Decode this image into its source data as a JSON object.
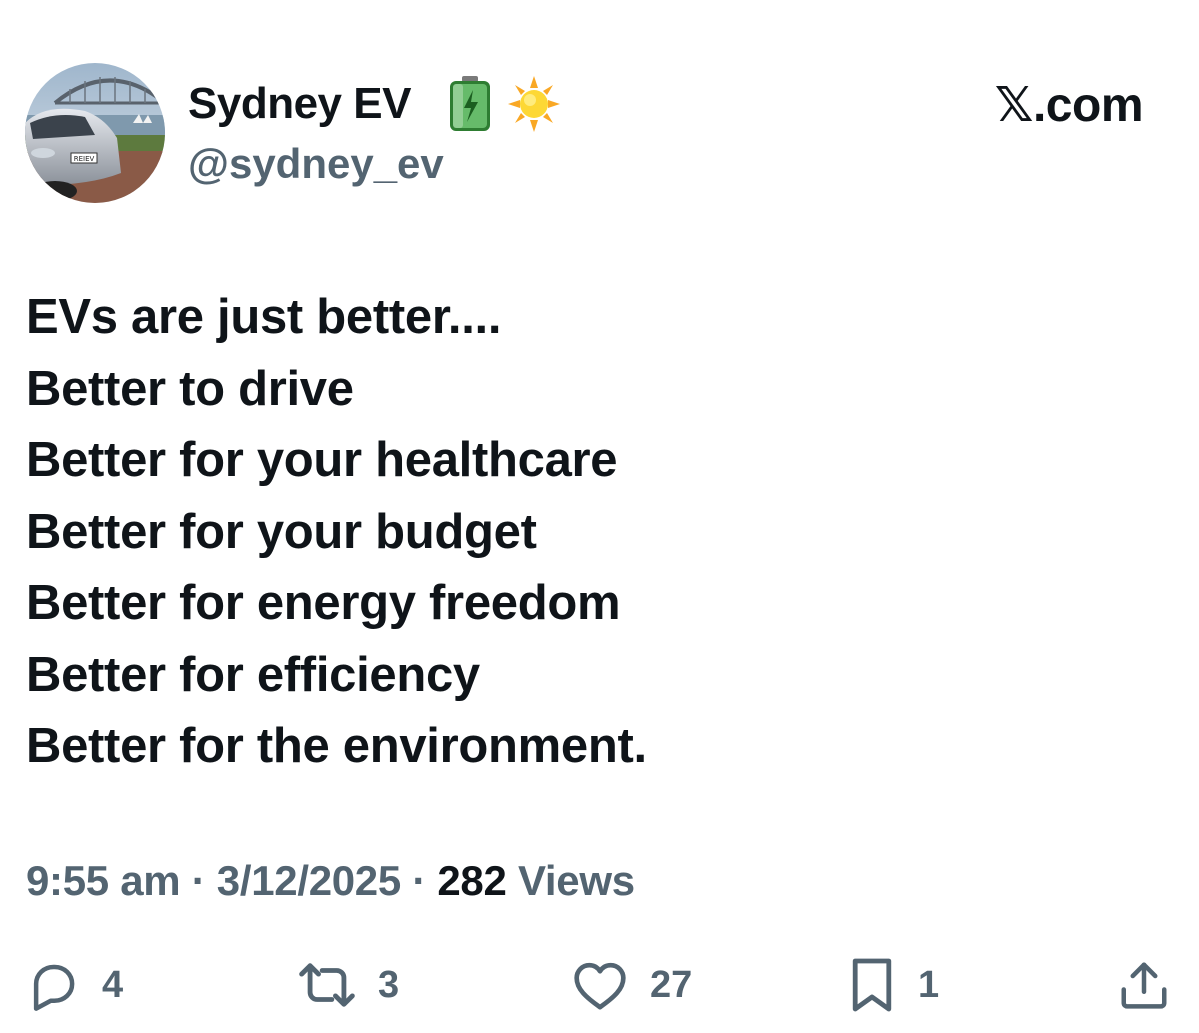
{
  "author": {
    "display_name": "Sydney EV",
    "handle": "@sydney_ev",
    "name_emojis": [
      "battery-emoji",
      "sun-emoji"
    ],
    "avatar": "avatar-photo"
  },
  "brand": "𝕏.com",
  "post": {
    "lines": [
      "EVs are just better....",
      "Better to drive",
      "Better for your healthcare",
      "Better for your budget",
      "Better for energy freedom",
      "Better for efficiency",
      "Better for the environment."
    ]
  },
  "meta": {
    "time": "9:55 am",
    "separator": "·",
    "date": "3/12/2025",
    "views_count": "282",
    "views_label": "Views"
  },
  "actions": {
    "replies": {
      "icon": "reply-icon",
      "count": "4"
    },
    "reposts": {
      "icon": "repost-icon",
      "count": "3"
    },
    "likes": {
      "icon": "heart-icon",
      "count": "27"
    },
    "bookmarks": {
      "icon": "bookmark-icon",
      "count": "1"
    },
    "share": {
      "icon": "share-icon"
    }
  },
  "colors": {
    "text_primary": "#0f1419",
    "text_secondary": "#536471",
    "battery_green": "#4caf50",
    "sun_yellow": "#fdd835"
  }
}
